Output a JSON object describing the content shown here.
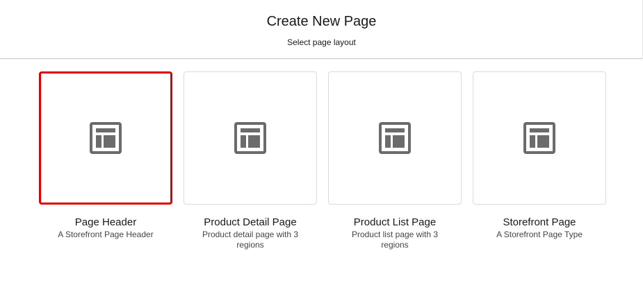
{
  "dialog": {
    "title": "Create New Page",
    "subtitle": "Select page layout"
  },
  "layouts": [
    {
      "label": "Page Header",
      "description": "A Storefront Page Header",
      "icon": "page-layout-icon",
      "selected": true
    },
    {
      "label": "Product Detail Page",
      "description": "Product detail page with 3 regions",
      "icon": "page-layout-icon",
      "selected": false
    },
    {
      "label": "Product List Page",
      "description": "Product list page with 3 regions",
      "icon": "page-layout-icon",
      "selected": false
    },
    {
      "label": "Storefront Page",
      "description": "A Storefront Page Type",
      "icon": "page-layout-icon",
      "selected": false
    }
  ],
  "colors": {
    "selected_border": "#e00000",
    "tile_border": "#dddbda",
    "icon": "#6b6b6b"
  }
}
